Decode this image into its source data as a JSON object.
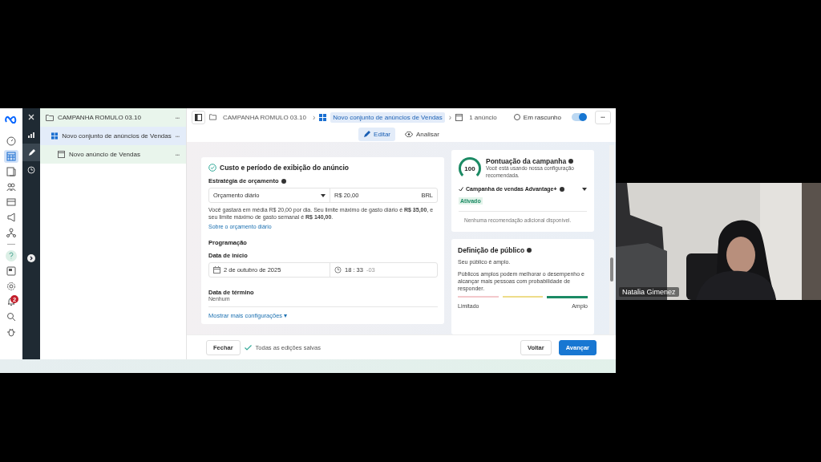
{
  "left_rail_top": [
    {
      "kind": "gauge",
      "selected": false
    },
    {
      "kind": "table",
      "selected": true
    },
    {
      "kind": "pages",
      "selected": false
    },
    {
      "kind": "people",
      "selected": false
    },
    {
      "kind": "card",
      "selected": false
    },
    {
      "kind": "megaphone",
      "selected": false
    },
    {
      "kind": "network",
      "selected": false
    }
  ],
  "left_rail_bottom": [
    {
      "kind": "help",
      "selected": false
    },
    {
      "kind": "news",
      "selected": false
    },
    {
      "kind": "gear",
      "selected": false
    },
    {
      "kind": "bell",
      "selected": false,
      "badge": "2"
    },
    {
      "kind": "search",
      "selected": false
    },
    {
      "kind": "bug",
      "selected": false
    }
  ],
  "tool_rail": [
    {
      "kind": "close",
      "selected": false
    },
    {
      "kind": "chart",
      "selected": false
    },
    {
      "kind": "pencil",
      "selected": true
    },
    {
      "kind": "clock",
      "selected": false
    }
  ],
  "tree": [
    {
      "label": "CAMPANHA ROMULO 03.10",
      "kind": "campaign",
      "selected": false,
      "menu": "•••",
      "children": [
        {
          "label": "Novo conjunto de anúncios de Vendas",
          "kind": "adset",
          "selected": true,
          "menu": "•••",
          "children": [
            {
              "label": "Novo anúncio de Vendas",
              "kind": "ad",
              "selected": false,
              "menu": "•••"
            }
          ]
        }
      ]
    }
  ],
  "breadcrumb": [
    {
      "label": "CAMPANHA ROMULO 03.10",
      "kind": "campaign",
      "selected": false
    },
    {
      "label": "Novo conjunto de anúncios de Vendas",
      "kind": "adset",
      "selected": true,
      "separator": "›"
    },
    {
      "label": "1 anúncio",
      "kind": "ad",
      "selected": false,
      "separator": "›"
    }
  ],
  "status": {
    "label": "Em rascunho",
    "on": true,
    "menu": "•••"
  },
  "tabs": [
    {
      "label": "Editar",
      "kind": "edit",
      "selected": true
    },
    {
      "label": "Analisar",
      "kind": "view",
      "selected": false
    }
  ],
  "budget_section": {
    "title": "Custo e período de exibição do anúncio",
    "strategy_label": "Estratégia de orçamento",
    "strategy_value": "Orçamento diário",
    "amount": "R$ 20,00",
    "currency": "BRL",
    "note": "Você gastará em média R$ 20,00 por dia. Seu limite máximo de gasto diário é **R$ 35,00**, e seu limite máximo de gasto semanal é **R$ 140,00**.",
    "link": "Sobre o orçamento diário",
    "schedule_title": "Programação",
    "start_label": "Data de início",
    "start_date": "2 de outubro de 2025",
    "start_time": "18 : 33",
    "timezone": "-03",
    "end_label": "Data de término",
    "end_value": "Nenhum",
    "more_link": "Mostrar mais configurações ▾"
  },
  "score_card": {
    "score": "100",
    "title": "Pontuação da campanha",
    "subtitle": "Você está usando nossa configuração recomendada.",
    "feature": "Campanha de vendas Advantage+",
    "feature_status": "Ativado",
    "empty": "Nenhuma recomendação adicional disponível."
  },
  "audience_card": {
    "title": "Definição de público",
    "summary": "Seu público é amplo.",
    "text": "Públicos amplos podem melhorar o desempenho e alcançar mais pessoas com probabilidade de responder.",
    "segments": [
      {
        "color": "#f3c9cc",
        "selected": false
      },
      {
        "color": "#eedc8a",
        "selected": false
      },
      {
        "color": "#1b8a64",
        "selected": true
      }
    ],
    "min_label": "Limitado",
    "max_label": "Amplo"
  },
  "footer": {
    "close": "Fechar",
    "saved": "Todas as edições salvas",
    "back": "Voltar",
    "next": "Avançar"
  },
  "video": {
    "kind": "picture",
    "name": "Natalia Gimenez"
  }
}
